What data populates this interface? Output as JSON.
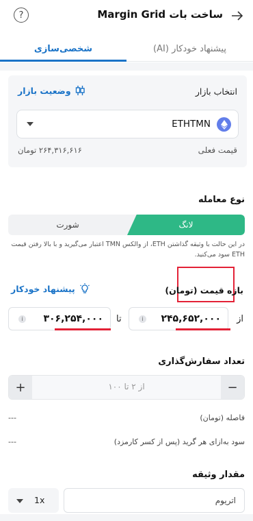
{
  "header": {
    "title": "ساخت بات Margin Grid",
    "back_icon": "arrow-right-icon",
    "help_label": "?"
  },
  "tabs": [
    {
      "label": "پیشنهاد خودکار (AI)",
      "active": false
    },
    {
      "label": "شخصی‌سازی",
      "active": true
    }
  ],
  "market": {
    "label": "انتخاب بازار",
    "status_link": "وضعیت بازار",
    "selected": "ETHTMN",
    "current_price_label": "قیمت فعلی",
    "current_price_value": "۲۶۴,۳۱۶,۶۱۶ تومان"
  },
  "trade_type": {
    "title": "نوع معامله",
    "long_label": "لانگ",
    "short_label": "شورت",
    "selected": "long",
    "note": "در این حالت با وثیقه گذاشتن ETH، از والکس TMN اعتبار می‌گیرید و با بالا رفتن قیمت ETH سود می‌کنید."
  },
  "price_range": {
    "title": "بازه قیمت (تومان)",
    "auto_suggest": "پیشنهاد خودکار",
    "from_label": "از",
    "to_label": "تا",
    "from_value": "۲۴۵,۶۵۲,۰۰۰",
    "to_value": "۳۰۶,۲۵۴,۰۰۰",
    "info_glyph": "i"
  },
  "order_count": {
    "title": "تعداد سفارش‌گذاری",
    "placeholder": "از ۲ تا ۱۰۰",
    "minus": "−",
    "plus": "+"
  },
  "stats": [
    {
      "label": "فاصله (تومان)",
      "value": "---"
    },
    {
      "label": "سود به‌ازای هر گرید (پس از کسر کارمزد)",
      "value": "---"
    }
  ],
  "collateral": {
    "title": "مقدار وثیقه",
    "placeholder": "اتریوم",
    "leverage": "1x"
  },
  "colors": {
    "accent": "#1a73c7",
    "long_green": "#2eb886",
    "highlight_red": "#e32136"
  }
}
